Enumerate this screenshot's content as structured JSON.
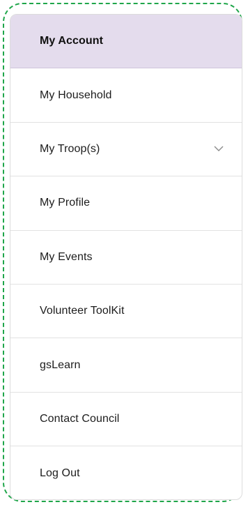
{
  "menu": {
    "items": [
      {
        "id": "my-account",
        "label": "My Account"
      },
      {
        "id": "my-household",
        "label": "My Household"
      },
      {
        "id": "my-troops",
        "label": "My Troop(s)"
      },
      {
        "id": "my-profile",
        "label": "My Profile"
      },
      {
        "id": "my-events",
        "label": "My Events"
      },
      {
        "id": "volunteer-toolkit",
        "label": "Volunteer ToolKit"
      },
      {
        "id": "gslearn",
        "label": "gsLearn"
      },
      {
        "id": "contact-council",
        "label": "Contact Council"
      },
      {
        "id": "log-out",
        "label": "Log Out"
      }
    ],
    "active_item": "My Account",
    "expandable_item": "My Troop(s)",
    "icons": {
      "expand": "chevron-down-icon"
    }
  },
  "colors": {
    "active_background": "#e4dced",
    "focus_outline": "#1fa64a",
    "divider": "#e2e2e2",
    "text": "#1c1c1c"
  }
}
